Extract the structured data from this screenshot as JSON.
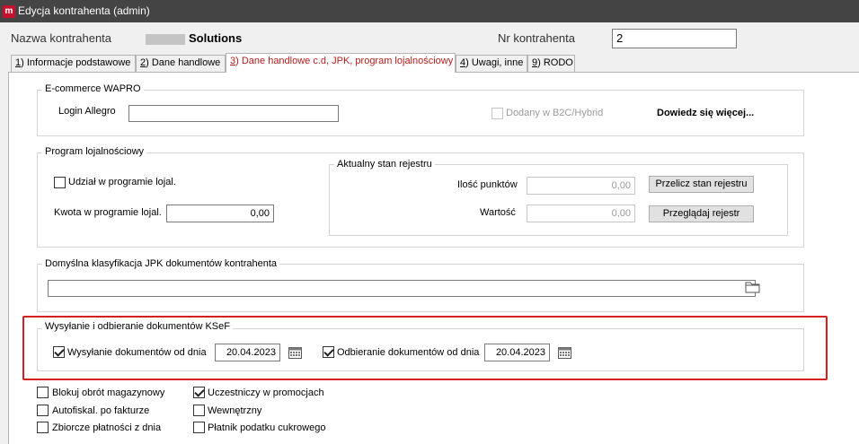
{
  "window": {
    "title": "Edycja kontrahenta (admin)",
    "app_icon_letter": "m"
  },
  "header": {
    "name_label": "Nazwa kontrahenta",
    "name_value": "Solutions",
    "nr_label": "Nr kontrahenta",
    "nr_value": "2"
  },
  "tabs": [
    {
      "key": "1",
      "label": ") Informacje podstawowe"
    },
    {
      "key": "2",
      "label": ") Dane handlowe"
    },
    {
      "key": "3",
      "label": ") Dane handlowe c.d, JPK, program lojalnościowy",
      "active": true
    },
    {
      "key": "4",
      "label": ") Uwagi, inne"
    },
    {
      "key": "9",
      "label": ") RODO"
    }
  ],
  "ecommerce": {
    "legend": "E-commerce WAPRO",
    "login_label": "Login Allegro",
    "login_value": "",
    "b2c_label": "Dodany w B2C/Hybrid",
    "b2c_checked": false,
    "more_link": "Dowiedz się więcej..."
  },
  "loyalty": {
    "legend": "Program lojalnościowy",
    "participate_label": "Udział w programie lojal.",
    "participate_checked": false,
    "amount_label": "Kwota w programie lojal.",
    "amount_value": "0,00",
    "registry": {
      "legend": "Aktualny stan rejestru",
      "points_label": "Ilość punktów",
      "points_value": "0,00",
      "value_label": "Wartość",
      "value_value": "0,00",
      "recalc_button": "Przelicz stan rejestru",
      "browse_button": "Przeglądaj rejestr"
    }
  },
  "jpk": {
    "legend": "Domyślna klasyfikacja JPK dokumentów kontrahenta",
    "value": ""
  },
  "ksef": {
    "legend": "Wysyłanie i odbieranie dokumentów KSeF",
    "send_label": "Wysyłanie dokumentów od dnia",
    "send_checked": true,
    "send_date": "20.04.2023",
    "receive_label": "Odbieranie dokumentów od dnia",
    "receive_checked": true,
    "receive_date": "20.04.2023"
  },
  "options": {
    "block_turnover": "Blokuj obrót magazynowy",
    "autofiskal": "Autofiskal. po fakturze",
    "collective_payments": "Zbiorcze płatności z dnia",
    "promotions": "Uczestniczy w promocjach",
    "internal": "Wewnętrzny",
    "sugar_tax": "Płatnik podatku cukrowego"
  },
  "colors": {
    "titlebar": "#444444",
    "active_tab_text": "#b51c1c",
    "highlight_frame": "#d52020",
    "app_icon": "#c8102e"
  }
}
